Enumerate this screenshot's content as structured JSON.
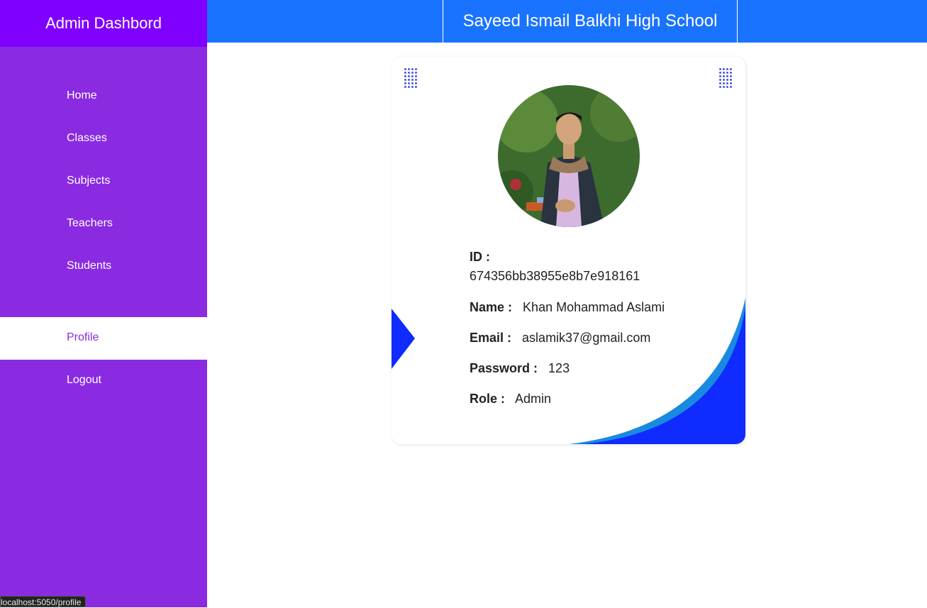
{
  "sidebar": {
    "brand": "Admin Dashbord",
    "items": [
      {
        "label": "Home"
      },
      {
        "label": "Classes"
      },
      {
        "label": "Subjects"
      },
      {
        "label": "Teachers"
      },
      {
        "label": "Students"
      },
      {
        "label": "Profile",
        "active": true
      },
      {
        "label": "Logout"
      }
    ]
  },
  "header": {
    "title": "Sayeed Ismail Balkhi High School"
  },
  "profile": {
    "id_label": "ID :",
    "id_value": "674356bb38955e8b7e918161",
    "name_label": "Name :",
    "name_value": "Khan Mohammad Aslami",
    "email_label": "Email :",
    "email_value": "aslamik37@gmail.com",
    "password_label": "Password :",
    "password_value": "123",
    "role_label": "Role :",
    "role_value": "Admin"
  },
  "status_bar": {
    "url": "localhost:5050/profile"
  },
  "colors": {
    "sidebar": "#8a2be2",
    "brand": "#8000ff",
    "topbar": "#1a73ff",
    "accent_blue": "#0f2bff",
    "active_text": "#8a2be2"
  }
}
